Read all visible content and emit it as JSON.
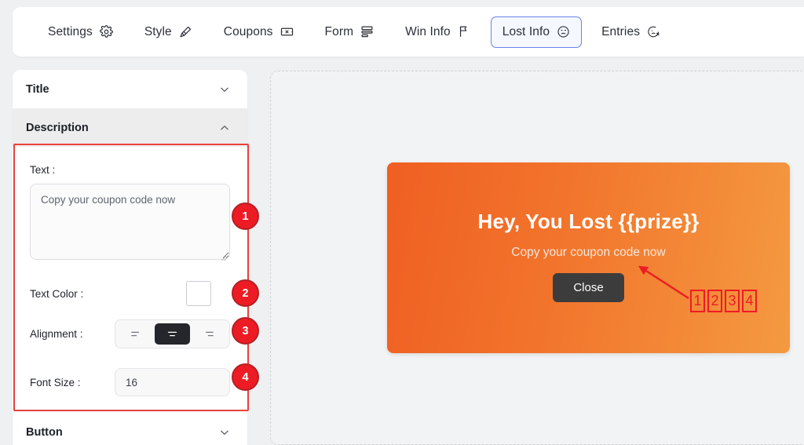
{
  "topbar": {
    "tabs": [
      {
        "label": "Settings",
        "icon": "gear-icon",
        "active": false
      },
      {
        "label": "Style",
        "icon": "brush-icon",
        "active": false
      },
      {
        "label": "Coupons",
        "icon": "ticket-icon",
        "active": false
      },
      {
        "label": "Form",
        "icon": "form-icon",
        "active": false
      },
      {
        "label": "Win Info",
        "icon": "flag-icon",
        "active": false
      },
      {
        "label": "Lost Info",
        "icon": "sad-face-icon",
        "active": true
      },
      {
        "label": "Entries",
        "icon": "face-x-icon",
        "active": false
      }
    ]
  },
  "sidebar": {
    "sections": [
      {
        "title": "Title",
        "state": "collapsed",
        "chevron": "chevron-down-icon"
      },
      {
        "title": "Description",
        "state": "expanded",
        "chevron": "chevron-up-icon"
      },
      {
        "title": "Button",
        "state": "collapsed",
        "chevron": "chevron-down-icon"
      }
    ],
    "description": {
      "text_label": "Text :",
      "text_value": "Copy your coupon code now",
      "text_placeholder": "Copy your coupon code now",
      "color_label": "Text Color :",
      "color_value": "#ffffff",
      "alignment_label": "Alignment :",
      "alignment_options": [
        {
          "name": "align-left-icon",
          "value": "left",
          "selected": false
        },
        {
          "name": "align-center-icon",
          "value": "center",
          "selected": true
        },
        {
          "name": "align-right-icon",
          "value": "right",
          "selected": false
        }
      ],
      "alignment_selected": "center",
      "font_size_label": "Font Size :",
      "font_size_value": "16"
    }
  },
  "annotations": {
    "badges": [
      "1",
      "2",
      "3",
      "4"
    ],
    "preview_tags": [
      "1",
      "2",
      "3",
      "4"
    ],
    "highlight_color": "#e8413a",
    "badge_color": "#ed1c24"
  },
  "preview": {
    "popup": {
      "title": "Hey, You Lost {{prize}}",
      "description": "Copy your coupon code now",
      "button_label": "Close",
      "gradient_start": "#ef5f22",
      "gradient_end": "#f49a41",
      "button_color": "#3c3c3c"
    }
  }
}
